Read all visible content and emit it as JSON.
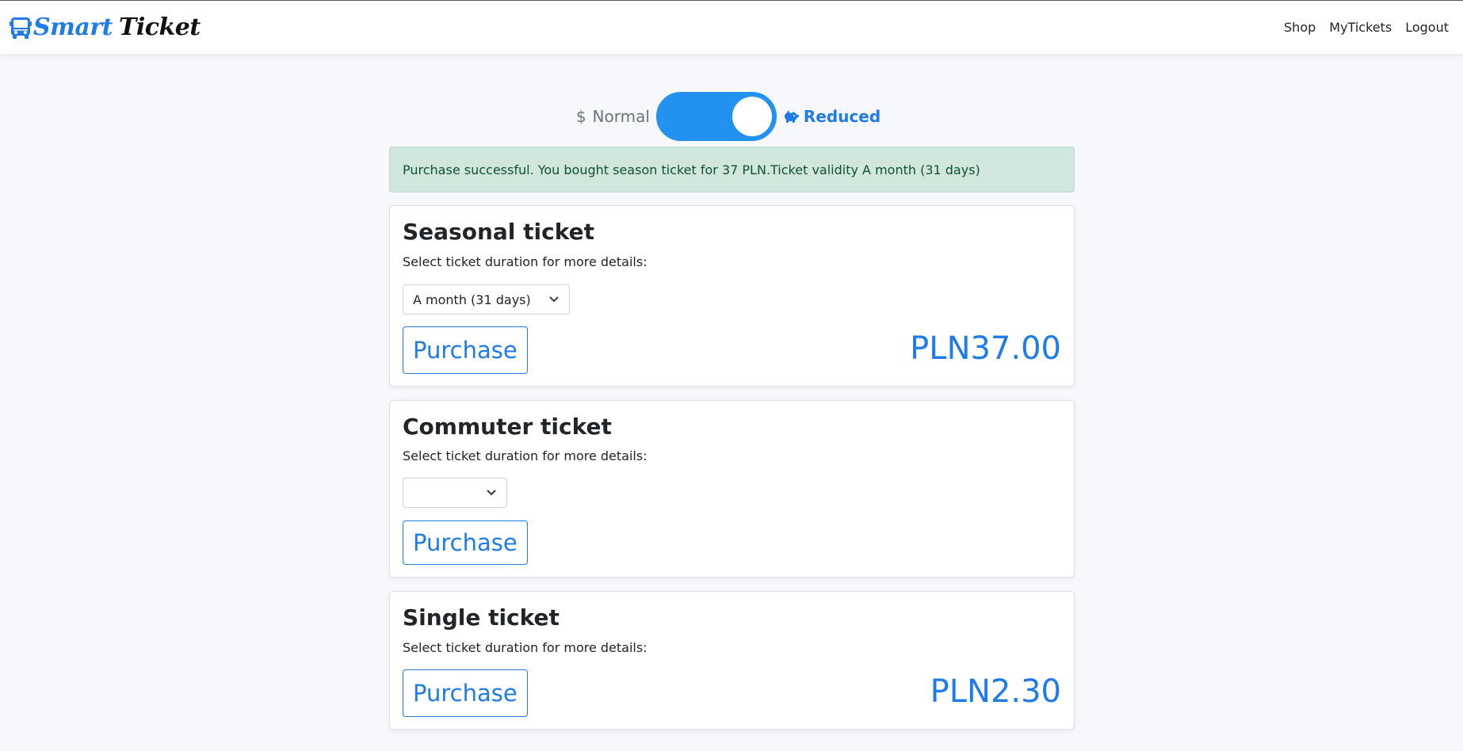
{
  "brand": {
    "smart": "Smart",
    "ticket": "Ticket",
    "logo_icon": "bus-icon"
  },
  "nav": {
    "shop": "Shop",
    "my_tickets": "MyTickets",
    "logout": "Logout"
  },
  "toggle": {
    "normal_icon": "dollar",
    "normal_symbol": "$",
    "normal_label": "Normal",
    "reduced_icon": "piggy-bank-icon",
    "reduced_label": "Reduced",
    "state": "reduced",
    "accent": "#2291f0"
  },
  "alert": {
    "message": "Purchase successful. You bought season ticket for 37 PLN.Ticket validity A month (31 days)"
  },
  "cards": [
    {
      "title": "Seasonal ticket",
      "subtitle": "Select ticket duration for more details:",
      "selected": "A month (31 days)",
      "button": "Purchase",
      "price": "PLN37.00"
    },
    {
      "title": "Commuter ticket",
      "subtitle": "Select ticket duration for more details:",
      "selected": "",
      "button": "Purchase",
      "price": ""
    },
    {
      "title": "Single ticket",
      "subtitle": "Select ticket duration for more details:",
      "button": "Purchase",
      "price": "PLN2.30"
    }
  ]
}
